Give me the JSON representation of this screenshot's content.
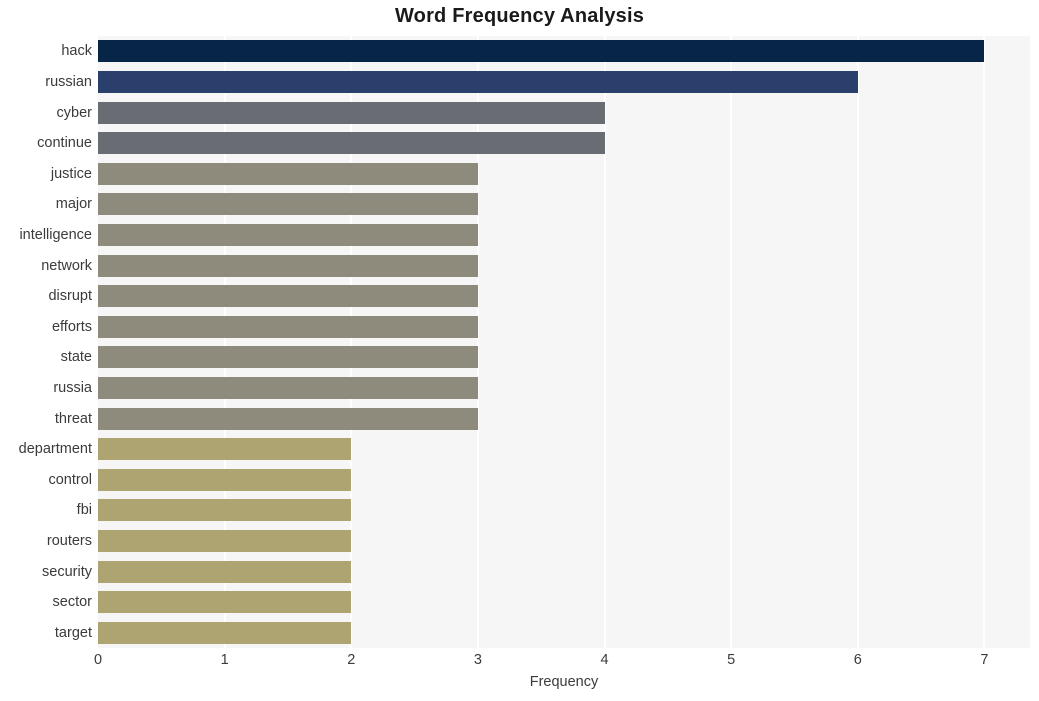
{
  "chart_data": {
    "type": "bar",
    "orientation": "horizontal",
    "title": "Word Frequency Analysis",
    "xlabel": "Frequency",
    "ylabel": "",
    "xlim": [
      0,
      7.36
    ],
    "xticks": [
      0,
      1,
      2,
      3,
      4,
      5,
      6,
      7
    ],
    "xtick_labels": [
      "0",
      "1",
      "2",
      "3",
      "4",
      "5",
      "6",
      "7"
    ],
    "grid": "vertical-white-on-light-gray",
    "legend": "none",
    "categories": [
      "hack",
      "russian",
      "cyber",
      "continue",
      "justice",
      "major",
      "intelligence",
      "network",
      "disrupt",
      "efforts",
      "state",
      "russia",
      "threat",
      "department",
      "control",
      "fbi",
      "routers",
      "security",
      "sector",
      "target"
    ],
    "values": [
      7,
      6,
      4,
      4,
      3,
      3,
      3,
      3,
      3,
      3,
      3,
      3,
      3,
      2,
      2,
      2,
      2,
      2,
      2,
      2
    ],
    "bar_colors": [
      "#072546",
      "#2b3f6c",
      "#696c72",
      "#696c72",
      "#8e8b7c",
      "#8e8b7c",
      "#8e8b7c",
      "#8e8b7c",
      "#8e8b7c",
      "#8e8b7c",
      "#8e8b7c",
      "#8e8b7c",
      "#8e8b7c",
      "#aea472",
      "#aea472",
      "#aea472",
      "#aea472",
      "#aea472",
      "#aea472",
      "#aea472"
    ],
    "plot_background": "#f6f6f7",
    "figure_background": "#ffffff",
    "title_color": "#1a1a1a",
    "tick_color": "#3b3b3b"
  }
}
